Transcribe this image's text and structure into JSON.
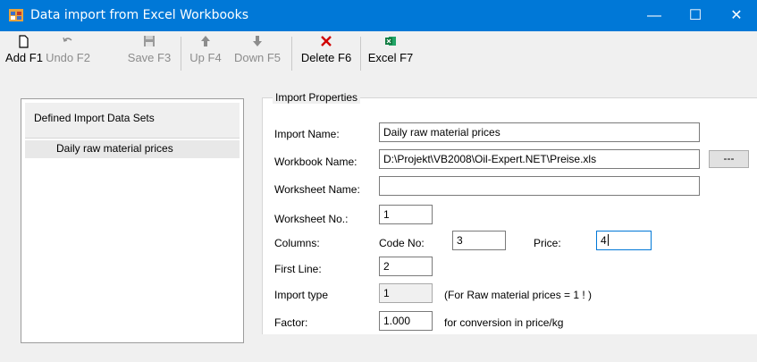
{
  "window": {
    "title": "Data import from Excel Workbooks",
    "controls": {
      "minimize": "—",
      "maximize": "☐",
      "close": "✕"
    },
    "accent_color": "#0078d7"
  },
  "toolbar": {
    "buttons": [
      {
        "label": "Add F1",
        "icon": "new-document-icon",
        "enabled": true
      },
      {
        "label": "Undo F2",
        "icon": "undo-icon",
        "enabled": false
      },
      {
        "label": "Save F3",
        "icon": "save-icon",
        "enabled": false
      },
      {
        "label": "Up F4",
        "icon": "arrow-up-icon",
        "enabled": false
      },
      {
        "label": "Down F5",
        "icon": "arrow-down-icon",
        "enabled": false
      },
      {
        "label": "Delete F6",
        "icon": "delete-x-icon",
        "enabled": true
      },
      {
        "label": "Excel F7",
        "icon": "excel-icon",
        "enabled": true
      }
    ]
  },
  "sets_panel": {
    "header": "Defined Import Data Sets",
    "items": [
      "Daily raw material prices"
    ]
  },
  "import_properties": {
    "legend": "Import Properties",
    "import_name": {
      "label": "Import Name:",
      "value": "Daily raw material prices"
    },
    "workbook_name": {
      "label": "Workbook Name:",
      "value": "D:\\Projekt\\VB2008\\Oil-Expert.NET\\Preise.xls",
      "browse": "---"
    },
    "worksheet_name": {
      "label": "Worksheet Name:",
      "value": ""
    },
    "worksheet_no": {
      "label": "Worksheet No.:",
      "value": "1"
    },
    "columns": {
      "label": "Columns:",
      "code_label": "Code No:",
      "code_value": "3",
      "price_label": "Price:",
      "price_value": "4"
    },
    "first_line": {
      "label": "First Line:",
      "value": "2"
    },
    "import_type": {
      "label": "Import type",
      "value": "1",
      "note": "(For Raw material prices = 1 ! )"
    },
    "factor": {
      "label": "Factor:",
      "value": "1.000",
      "note": "for conversion in price/kg"
    }
  }
}
